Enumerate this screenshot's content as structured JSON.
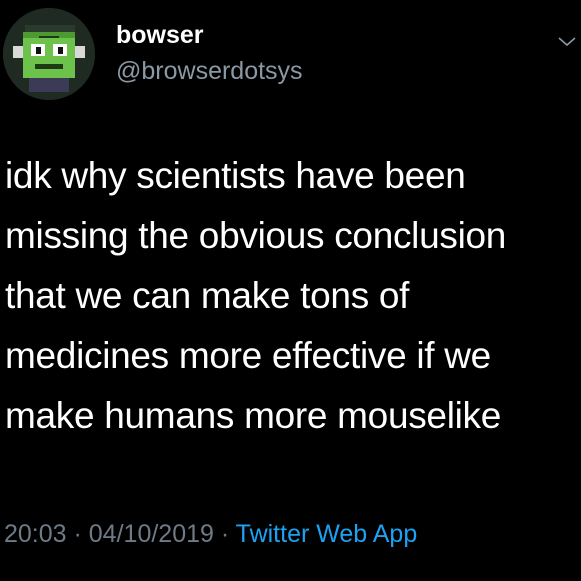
{
  "colors": {
    "background": "#000000",
    "text": "#ffffff",
    "secondary_text": "#8b98a5",
    "link": "#1da1f2"
  },
  "user": {
    "display_name": "bowser",
    "handle": "@browserdotsys",
    "avatar_icon": "pixel-frankenstein-avatar"
  },
  "tweet": {
    "lines": [
      "idk why scientists have been",
      "missing the obvious conclusion",
      "that we can make tons of",
      "medicines more effective if we",
      "make humans more mouselike"
    ]
  },
  "meta": {
    "time": "20:03",
    "date": "04/10/2019",
    "separator": " · ",
    "source": "Twitter Web App"
  },
  "icons": {
    "menu": "chevron-down-icon"
  }
}
